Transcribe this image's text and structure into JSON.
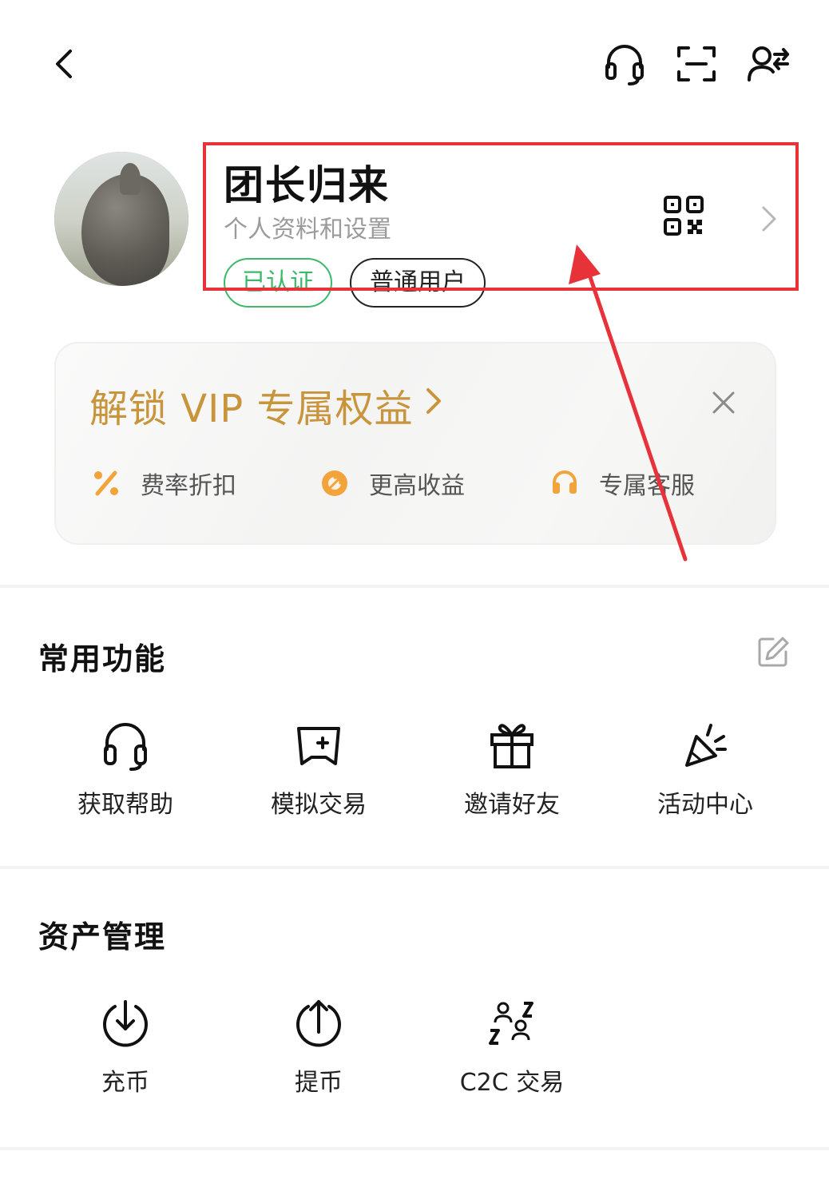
{
  "profile": {
    "nickname": "团长归来",
    "subtitle": "个人资料和设置",
    "badges": {
      "verified": "已认证",
      "level": "普通用户"
    }
  },
  "top_bar_icons": [
    "back-icon",
    "headset-icon",
    "scan-icon",
    "switch-account-icon"
  ],
  "vip": {
    "title": "解锁 VIP 专属权益",
    "perks": [
      {
        "icon": "percent-icon",
        "label": "费率折扣"
      },
      {
        "icon": "earnings-icon",
        "label": "更高收益"
      },
      {
        "icon": "headset-icon",
        "label": "专属客服"
      }
    ]
  },
  "common_functions": {
    "title": "常用功能",
    "items": [
      {
        "icon": "headset-icon",
        "label": "获取帮助"
      },
      {
        "icon": "demo-trading-icon",
        "label": "模拟交易"
      },
      {
        "icon": "gift-icon",
        "label": "邀请好友"
      },
      {
        "icon": "party-popper-icon",
        "label": "活动中心"
      }
    ]
  },
  "asset_management": {
    "title": "资产管理",
    "items": [
      {
        "icon": "deposit-icon",
        "label": "充币"
      },
      {
        "icon": "withdraw-icon",
        "label": "提币"
      },
      {
        "icon": "c2c-icon",
        "label": "C2C 交易"
      }
    ]
  },
  "colors": {
    "highlight": "#e8323a",
    "vip_gold": "#c8943c",
    "verified_green": "#3bb86a",
    "perk_orange": "#f2a33a"
  }
}
